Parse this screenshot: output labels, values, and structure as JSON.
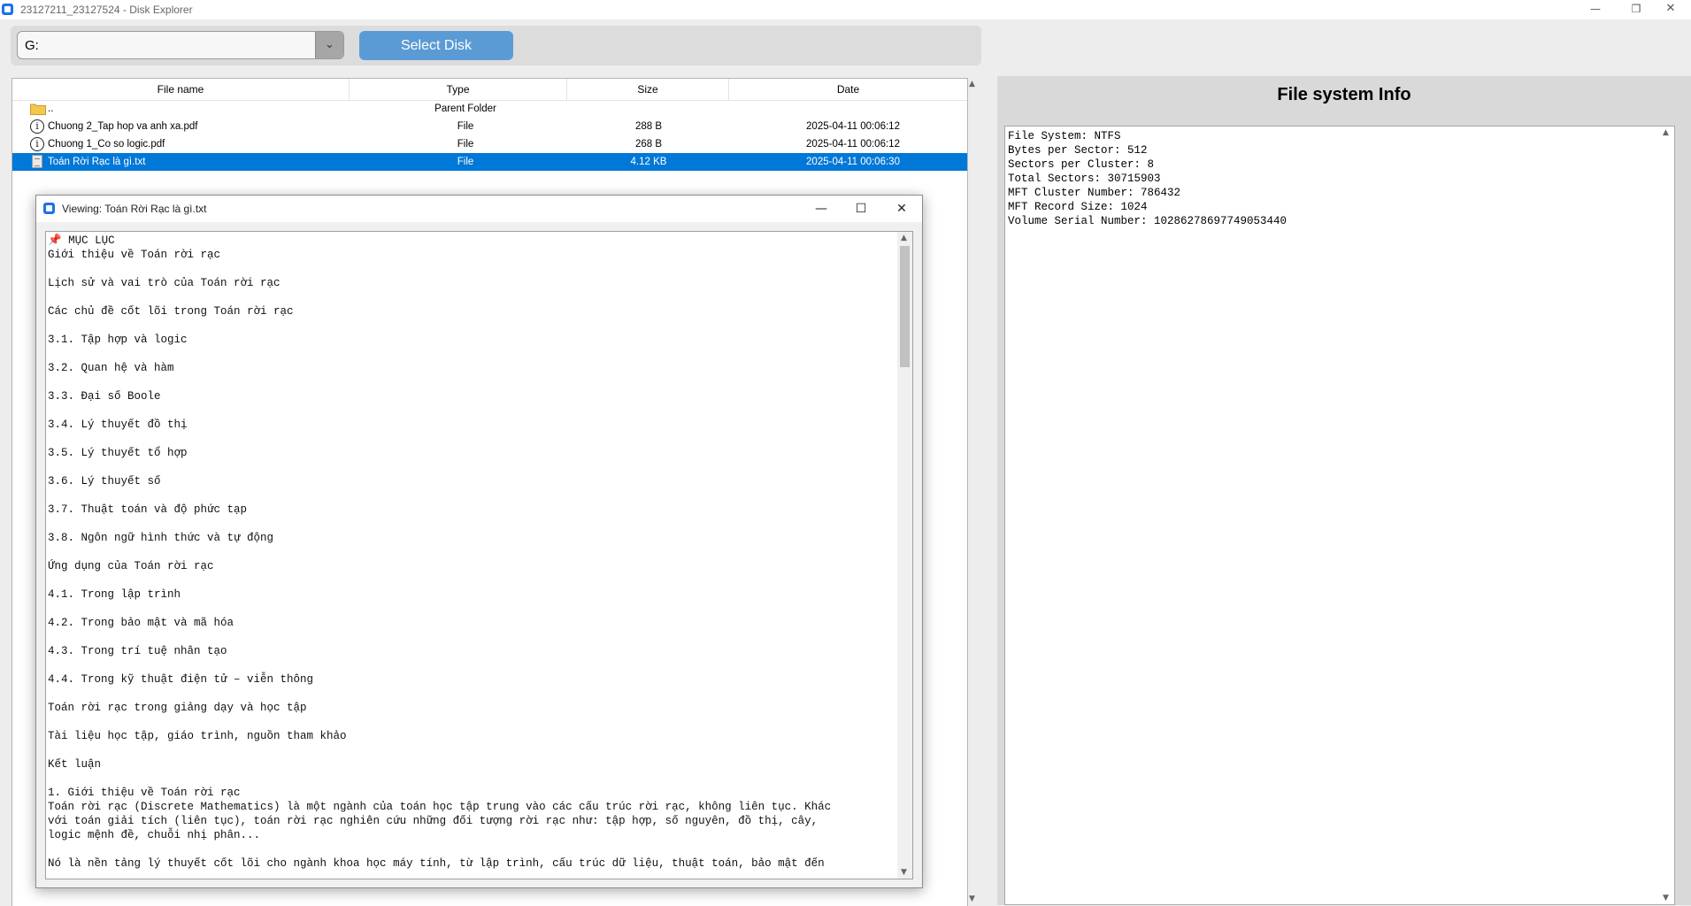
{
  "window": {
    "title": "23127211_23127524 - Disk Explorer",
    "controls": {
      "minimize": "—",
      "restore": "❐",
      "close": "✕"
    }
  },
  "toolbar": {
    "disk_value": "G:",
    "dropdown_icon": "chevron-down-icon",
    "select_button": "Select Disk"
  },
  "file_table": {
    "columns": [
      "File name",
      "Type",
      "Size",
      "Date"
    ],
    "rows": [
      {
        "icon": "folder-icon",
        "name": "..",
        "type": "Parent Folder",
        "size": "",
        "date": ""
      },
      {
        "icon": "info-icon",
        "name": "Chuong 2_Tap hop va anh xa.pdf",
        "type": "File",
        "size": "288 B",
        "date": "2025-04-11 00:06:12"
      },
      {
        "icon": "info-icon",
        "name": "Chuong 1_Co so logic.pdf",
        "type": "File",
        "size": "268 B",
        "date": "2025-04-11 00:06:12"
      },
      {
        "icon": "text-file-icon",
        "name": "Toán Rời Rạc là gì.txt",
        "type": "File",
        "size": "4.12 KB",
        "date": "2025-04-11 00:06:30",
        "selected": true
      }
    ]
  },
  "fs_info": {
    "title": "File system Info",
    "lines": [
      "File System: NTFS",
      "Bytes per Sector: 512",
      "Sectors per Cluster: 8",
      "Total Sectors: 30715903",
      "MFT Cluster Number: 786432",
      "MFT Record Size: 1024",
      "Volume Serial Number: 10286278697749053440"
    ]
  },
  "viewer": {
    "title": "Viewing: Toán Rời Rạc là gì.txt",
    "controls": {
      "minimize": "—",
      "maximize": "☐",
      "close": "✕"
    },
    "content": "📌 MỤC LỤC\nGiới thiệu về Toán rời rạc\n\nLịch sử và vai trò của Toán rời rạc\n\nCác chủ đề cốt lõi trong Toán rời rạc\n\n3.1. Tập hợp và logic\n\n3.2. Quan hệ và hàm\n\n3.3. Đại số Boole\n\n3.4. Lý thuyết đồ thị\n\n3.5. Lý thuyết tổ hợp\n\n3.6. Lý thuyết số\n\n3.7. Thuật toán và độ phức tạp\n\n3.8. Ngôn ngữ hình thức và tự động\n\nỨng dụng của Toán rời rạc\n\n4.1. Trong lập trình\n\n4.2. Trong bảo mật và mã hóa\n\n4.3. Trong trí tuệ nhân tạo\n\n4.4. Trong kỹ thuật điện tử – viễn thông\n\nToán rời rạc trong giảng dạy và học tập\n\nTài liệu học tập, giáo trình, nguồn tham khảo\n\nKết luận\n\n1. Giới thiệu về Toán rời rạc\nToán rời rạc (Discrete Mathematics) là một ngành của toán học tập trung vào các cấu trúc rời rạc, không liên tục. Khác\nvới toán giải tích (liên tục), toán rời rạc nghiên cứu những đối tượng rời rạc như: tập hợp, số nguyên, đồ thị, cây,\nlogic mệnh đề, chuỗi nhị phân...\n\nNó là nền tảng lý thuyết cốt lõi cho ngành khoa học máy tính, từ lập trình, cấu trúc dữ liệu, thuật toán, bảo mật đến"
  }
}
